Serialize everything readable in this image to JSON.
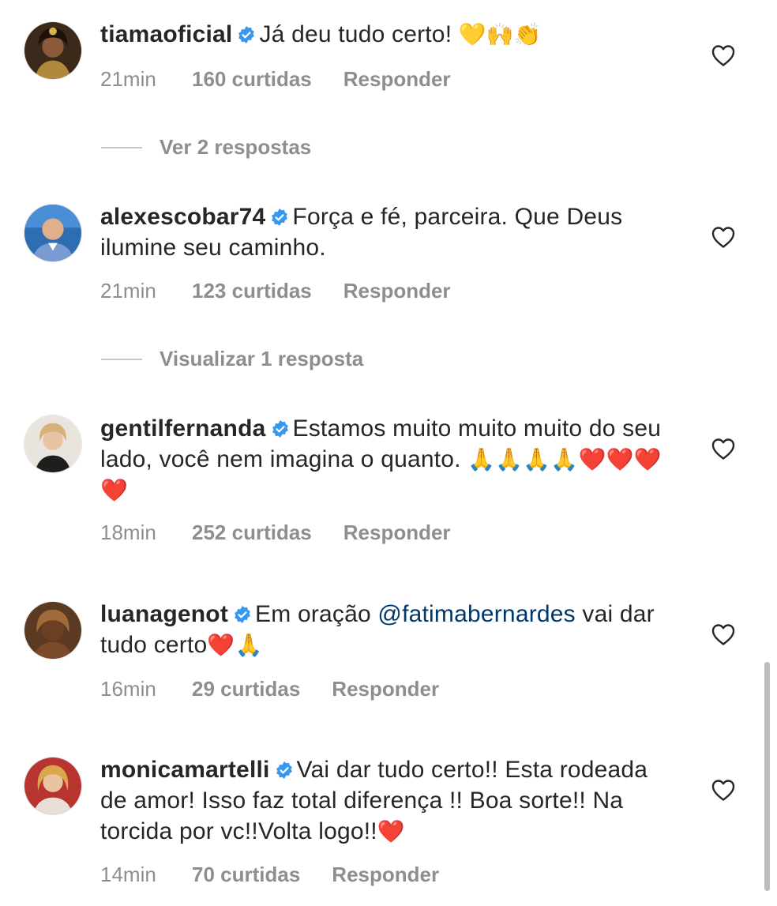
{
  "comments": [
    {
      "username": "tiamaoficial",
      "text": "Já deu tudo certo! ",
      "emojis": "💛🙌👏",
      "time": "21min",
      "likes": "160 curtidas",
      "reply": "Responder",
      "replies_link": "Ver 2 respostas"
    },
    {
      "username": "alexescobar74",
      "text": "Força e fé, parceira. Que Deus ilumine seu caminho.",
      "time": "21min",
      "likes": "123 curtidas",
      "reply": "Responder",
      "replies_link": "Visualizar 1 resposta"
    },
    {
      "username": "gentilfernanda",
      "text": "Estamos muito muito muito do seu lado, você nem imagina o quanto. ",
      "emojis": "🙏🙏🙏🙏❤️❤️❤️❤️",
      "time": "18min",
      "likes": "252 curtidas",
      "reply": "Responder"
    },
    {
      "username": "luanagenot",
      "text_before": "Em oração ",
      "mention": "@fatimabernardes",
      "text_after": " vai dar tudo certo",
      "emojis": "❤️🙏",
      "time": "16min",
      "likes": "29 curtidas",
      "reply": "Responder"
    },
    {
      "username": "monicamartelli",
      "text": "Vai dar tudo certo!! Esta rodeada de amor! Isso faz total diferença !! Boa sorte!! Na torcida por vc!!Volta logo!!",
      "emojis": "❤️",
      "time": "14min",
      "likes": "70 curtidas",
      "reply": "Responder"
    }
  ],
  "colors": {
    "text": "#262626",
    "muted": "#8e8e8e",
    "verified": "#3897f0",
    "mention": "#00376b"
  },
  "icons": {
    "verified": "verified-badge-icon",
    "heart": "heart-outline-icon"
  }
}
